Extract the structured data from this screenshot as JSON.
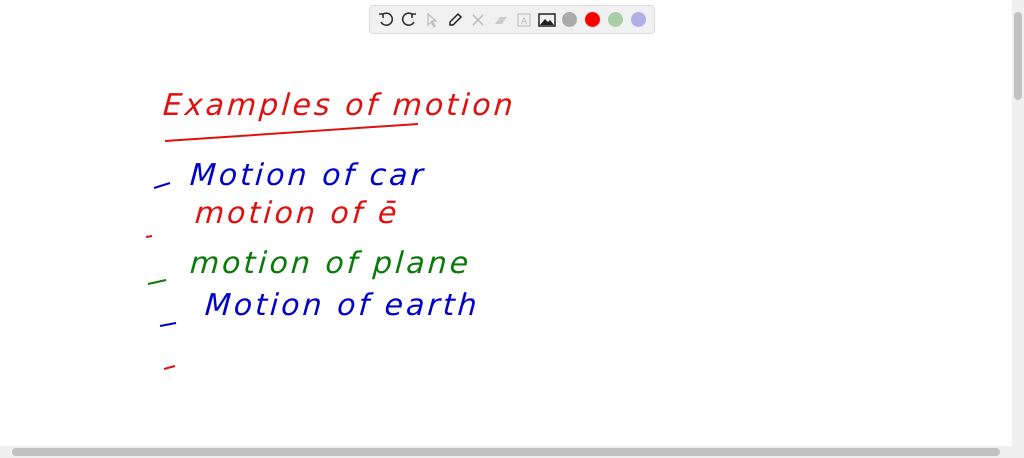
{
  "toolbar": {
    "tools": [
      "undo-icon",
      "redo-icon",
      "pointer-icon",
      "pen-icon",
      "tools-icon",
      "eraser-icon",
      "text-icon",
      "image-icon"
    ],
    "colors": [
      "#aaaaaa",
      "#ff0000",
      "#a8cfa8",
      "#b0b0e8"
    ]
  },
  "canvas": {
    "title": "Examples of motion",
    "lines": [
      {
        "text": "Motion of car",
        "color": "#0000cc"
      },
      {
        "text": "motion of ē",
        "color": "#e01010"
      },
      {
        "text": "motion of plane",
        "color": "#0a7a0a"
      },
      {
        "text": "Motion of earth",
        "color": "#0000cc"
      },
      {
        "text": "",
        "color": "#e01010"
      }
    ]
  }
}
